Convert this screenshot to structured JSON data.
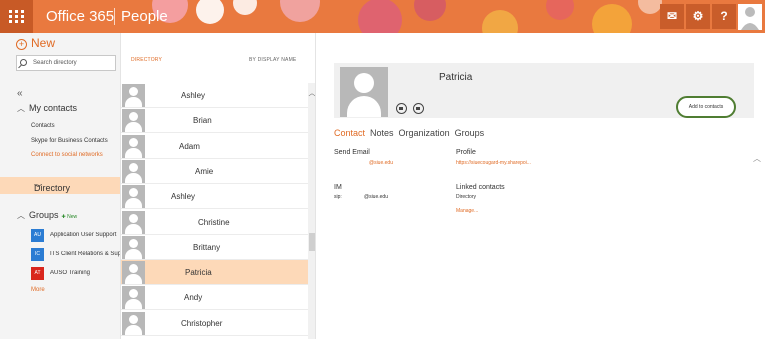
{
  "topbar": {
    "brand": "Office 365",
    "app": "People",
    "icons": [
      "waffle-icon",
      "notification-icon",
      "settings-gear-icon",
      "help-icon",
      "avatar"
    ],
    "help_label": "?"
  },
  "leftrail": {
    "new_label": "New",
    "search_placeholder": "Search directory",
    "collapse_glyph": "«",
    "my_contacts": "My contacts",
    "links": [
      "Contacts",
      "Skype for Business Contacts",
      "Connect to social networks"
    ],
    "directory": "Directory",
    "groups": "Groups",
    "groups_new_tag": "New",
    "group_items": [
      {
        "initials": "AU",
        "label": "Application User Support",
        "color": "#2b7cd3"
      },
      {
        "initials": "IC",
        "label": "ITS Client Relations & Support",
        "color": "#2b7cd3"
      },
      {
        "initials": "AT",
        "label": "AUSO Training",
        "color": "#d9261c"
      }
    ],
    "more": "More"
  },
  "list": {
    "header_left": "DIRECTORY",
    "header_right": "BY DISPLAY NAME",
    "people": [
      "Ashley",
      "Brian",
      "Adam",
      "Amie",
      "Ashley",
      "Christine",
      "Brittany",
      "Patricia",
      "Andy",
      "Christopher"
    ],
    "selected_index": 7
  },
  "detail": {
    "name": "Patricia",
    "add_to_contacts": "Add to contacts",
    "tabs": [
      "Contact",
      "Notes",
      "Organization",
      "Groups"
    ],
    "send_email_label": "Send Email",
    "email": "@siue.edu",
    "profile_label": "Profile",
    "profile_url": "https://siuecougard-my.sharepoi...",
    "im_label": "IM",
    "sip_prefix": "sip:",
    "sip": "@siue.edu",
    "linked_label": "Linked contacts",
    "linked_value": "Directory",
    "manage": "Manage..."
  },
  "colors": {
    "accent": "#e06b25",
    "selected": "#fdd9b8",
    "topbar": "#e8763b",
    "highlight_ring": "#4f7d32"
  }
}
